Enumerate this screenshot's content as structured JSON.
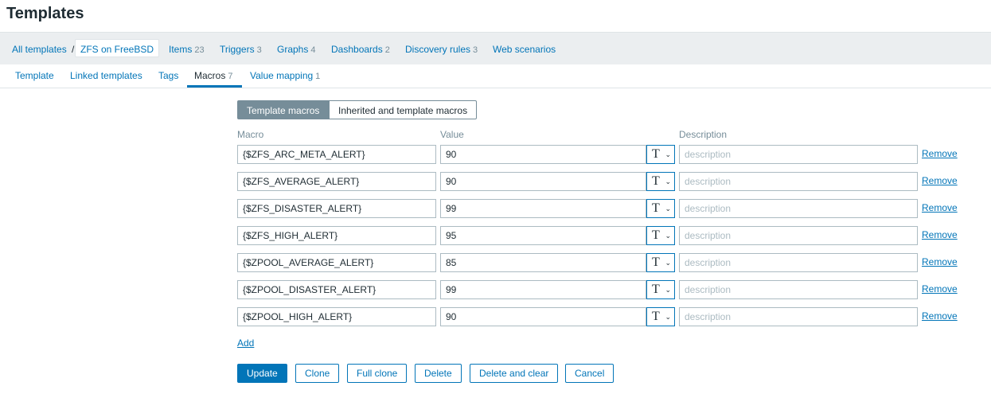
{
  "page": {
    "title": "Templates"
  },
  "breadcrumb": {
    "root": "All templates",
    "separator": "/",
    "current": "ZFS on FreeBSD",
    "links": [
      {
        "label": "Items",
        "count": "23"
      },
      {
        "label": "Triggers",
        "count": "3"
      },
      {
        "label": "Graphs",
        "count": "4"
      },
      {
        "label": "Dashboards",
        "count": "2"
      },
      {
        "label": "Discovery rules",
        "count": "3"
      },
      {
        "label": "Web scenarios",
        "count": ""
      }
    ]
  },
  "tabs": [
    {
      "label": "Template",
      "count": ""
    },
    {
      "label": "Linked templates",
      "count": ""
    },
    {
      "label": "Tags",
      "count": ""
    },
    {
      "label": "Macros",
      "count": "7"
    },
    {
      "label": "Value mapping",
      "count": "1"
    }
  ],
  "macro_filter": {
    "active": "Template macros",
    "inactive": "Inherited and template macros"
  },
  "columns": {
    "macro": "Macro",
    "value": "Value",
    "description": "Description"
  },
  "type_icon": {
    "glyph": "T",
    "chevron": "⌄"
  },
  "description_placeholder": "description",
  "remove_label": "Remove",
  "macros": [
    {
      "macro": "{$ZFS_ARC_META_ALERT}",
      "value": "90"
    },
    {
      "macro": "{$ZFS_AVERAGE_ALERT}",
      "value": "90"
    },
    {
      "macro": "{$ZFS_DISASTER_ALERT}",
      "value": "99"
    },
    {
      "macro": "{$ZFS_HIGH_ALERT}",
      "value": "95"
    },
    {
      "macro": "{$ZPOOL_AVERAGE_ALERT}",
      "value": "85"
    },
    {
      "macro": "{$ZPOOL_DISASTER_ALERT}",
      "value": "99"
    },
    {
      "macro": "{$ZPOOL_HIGH_ALERT}",
      "value": "90"
    }
  ],
  "add_label": "Add",
  "actions": {
    "update": "Update",
    "clone": "Clone",
    "full_clone": "Full clone",
    "delete": "Delete",
    "delete_and_clear": "Delete and clear",
    "cancel": "Cancel"
  },
  "colors": {
    "accent": "#0275b8",
    "muted": "#768d99",
    "header_bg": "#ebeef0"
  }
}
